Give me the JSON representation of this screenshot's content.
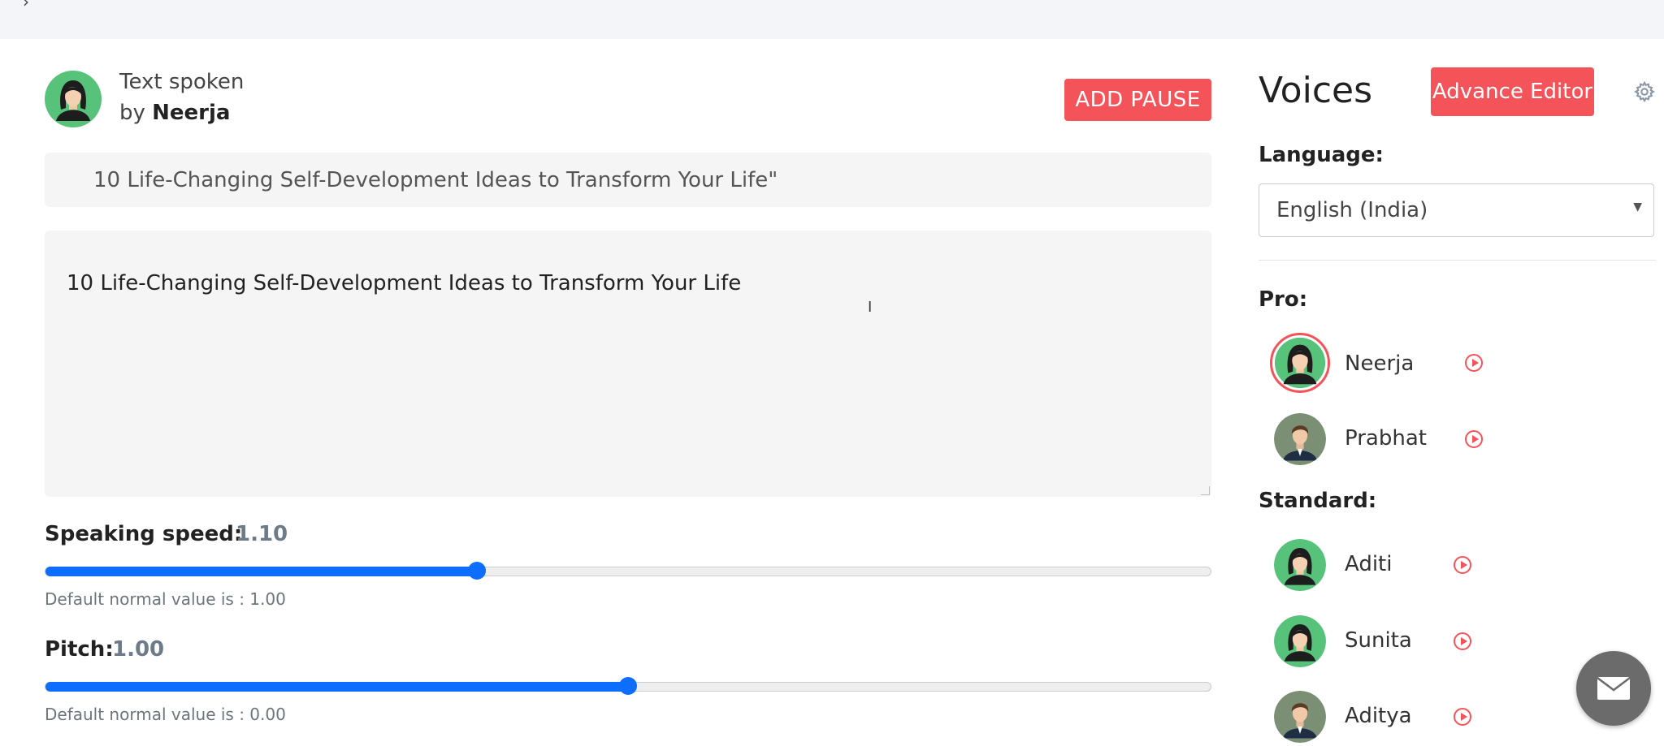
{
  "top_bar": {
    "glyph": "›"
  },
  "speaker": {
    "prefix": "Text spoken",
    "by_label": "by",
    "name": "Neerja"
  },
  "buttons": {
    "add_pause": "ADD PAUSE",
    "advance_editor": "Advance Editor"
  },
  "title_input": {
    "value": "10 Life-Changing Self-Development Ideas to Transform Your Life\""
  },
  "text_area": {
    "value": "10 Life-Changing Self-Development Ideas to Transform Your Life"
  },
  "speed": {
    "label": "Speaking speed:",
    "value": "1.10",
    "hint": "Default normal value is : 1.00",
    "fill_fraction": 0.37
  },
  "pitch": {
    "label": "Pitch:",
    "value": "1.00",
    "hint": "Default normal value is : 0.00",
    "fill_fraction": 0.5
  },
  "voices_panel": {
    "title": "Voices",
    "language_label": "Language:",
    "language_value": "English (India)",
    "pro_label": "Pro:",
    "standard_label": "Standard:",
    "pro": [
      {
        "name": "Neerja",
        "gender": "female",
        "selected": true
      },
      {
        "name": "Prabhat",
        "gender": "male",
        "selected": false
      }
    ],
    "standard": [
      {
        "name": "Aditi",
        "gender": "female"
      },
      {
        "name": "Sunita",
        "gender": "female"
      },
      {
        "name": "Aditya",
        "gender": "male"
      }
    ]
  },
  "icons": {
    "gear": "gear-icon",
    "play": "play-circle-icon",
    "chat": "chat-widget-icon"
  },
  "colors": {
    "accent": "#f5535a",
    "slider": "#0d6efd",
    "avatar_female_bg": "#57c27a",
    "avatar_male_bg": "#7b8f74"
  }
}
